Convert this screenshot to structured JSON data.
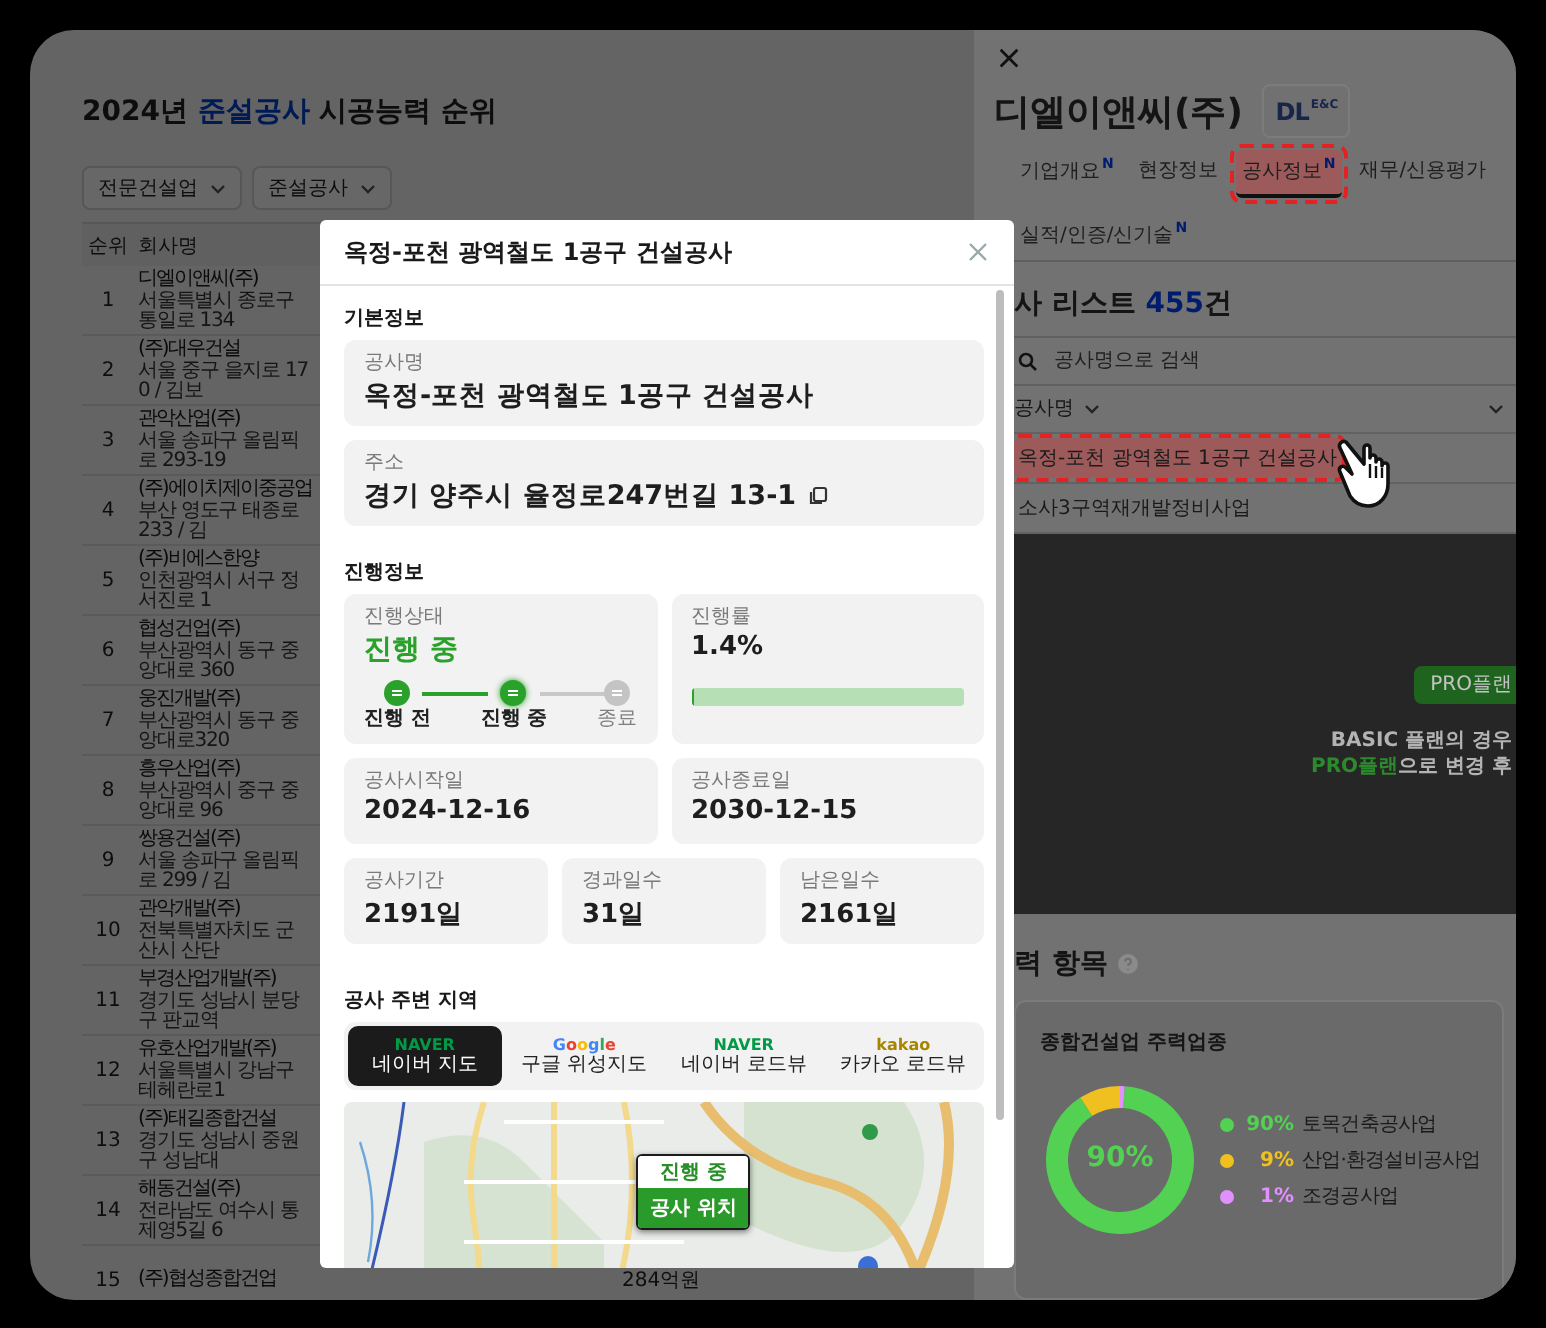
{
  "left_page": {
    "title": {
      "prefix": "2024년",
      "highlight": "준설공사",
      "suffix": "시공능력 순위"
    },
    "filters": [
      {
        "label": "전문건설업"
      },
      {
        "label": "준설공사"
      }
    ],
    "table": {
      "columns": [
        "순위",
        "회사명"
      ],
      "rows": [
        {
          "rank": "1",
          "name": "디엘이앤씨(주)",
          "address": "서울특별시 종로구 통일로 134"
        },
        {
          "rank": "2",
          "name": "(주)대우건설",
          "address": "서울 중구 을지로 170 / 김보"
        },
        {
          "rank": "3",
          "name": "관악산업(주)",
          "address": "서울 송파구 올림픽로 293-19"
        },
        {
          "rank": "4",
          "name": "(주)에이치제이중공업",
          "address": "부산 영도구 태종로 233 / 김"
        },
        {
          "rank": "5",
          "name": "(주)비에스한양",
          "address": "인천광역시 서구 정서진로 1"
        },
        {
          "rank": "6",
          "name": "협성건업(주)",
          "address": "부산광역시 동구 중앙대로 360"
        },
        {
          "rank": "7",
          "name": "웅진개발(주)",
          "address": "부산광역시 동구 중앙대로320"
        },
        {
          "rank": "8",
          "name": "흥우산업(주)",
          "address": "부산광역시 중구 중앙대로 96"
        },
        {
          "rank": "9",
          "name": "쌍용건설(주)",
          "address": "서울 송파구 올림픽로 299 / 김"
        },
        {
          "rank": "10",
          "name": "관악개발(주)",
          "address": "전북특별자치도 군산시 산단"
        },
        {
          "rank": "11",
          "name": "부경산업개발(주)",
          "address": "경기도 성남시 분당구 판교역"
        },
        {
          "rank": "12",
          "name": "유호산업개발(주)",
          "address": "서울특별시 강남구 테헤란로1"
        },
        {
          "rank": "13",
          "name": "(주)태길종합건설",
          "address": "경기도 성남시 중원구 성남대"
        },
        {
          "rank": "14",
          "name": "해동건설(주)",
          "address": "전라남도 여수시 통제영5길 6"
        },
        {
          "rank": "15",
          "name": "(주)협성종합건업",
          "amount": "284억원"
        }
      ]
    }
  },
  "panel": {
    "company": "디엘이앤씨(주)",
    "logo": {
      "mark": "DL",
      "sub": "E&C"
    },
    "tabs": [
      {
        "label": "기업개요",
        "badge": "N",
        "selected": false,
        "highlighted": false
      },
      {
        "label": "현장정보",
        "selected": false,
        "highlighted": false
      },
      {
        "label": "공사정보",
        "badge": "N",
        "selected": true,
        "highlighted": true
      },
      {
        "label": "재무/신용평가",
        "selected": false,
        "highlighted": false
      },
      {
        "label": "실적/인증/신기술",
        "badge": "N",
        "selected": false,
        "highlighted": false
      }
    ],
    "list": {
      "title": "사 리스트",
      "count": "455",
      "unit": "건",
      "search": {
        "placeholder": "공사명으로 검색"
      },
      "column": "공사명",
      "rows": [
        {
          "name": "옥정-포천 광역철도 1공구 건설공사",
          "highlighted": true
        },
        {
          "name": "소사3구역재개발정비사업",
          "highlighted": false
        }
      ]
    },
    "locked": {
      "button": "PRO플랜",
      "note": "BASIC 플랜의 경우",
      "note2": {
        "highlight": "PRO플랜",
        "rest": "으로 변경 후"
      }
    },
    "focus": {
      "title": "력 항목",
      "center_label": "90%",
      "chart_data": {
        "type": "donut",
        "title": "종합건설업 주력업종",
        "categories": [
          "토목건축공사업",
          "산업·환경설비공사업",
          "조경공사업"
        ],
        "values": [
          90,
          9,
          1
        ]
      },
      "legend": [
        {
          "value": "90%",
          "color": "#52d152"
        },
        {
          "value": "9%",
          "color": "#f0c020"
        },
        {
          "value": "1%",
          "color": "#e090ff"
        }
      ]
    }
  },
  "modal": {
    "title": "옥정-포천 광역철도 1공구 건설공사",
    "basic": {
      "heading": "기본정보",
      "fields": [
        {
          "label": "공사명",
          "value": "옥정-포천 광역철도 1공구 건설공사",
          "copyable": false
        },
        {
          "label": "주소",
          "value": "경기 양주시 율정로247번길 13-1",
          "copyable": true
        }
      ]
    },
    "progress": {
      "heading": "진행정보",
      "status": {
        "label": "진행상태",
        "value": "진행 중",
        "steps": [
          {
            "label": "진행 전",
            "reached": true,
            "current": false
          },
          {
            "label": "진행 중",
            "reached": true,
            "current": true
          },
          {
            "label": "종료",
            "reached": false,
            "current": false
          }
        ]
      },
      "rate": {
        "label": "진행률",
        "value": "1.4%",
        "level": 0.014
      },
      "dates": [
        {
          "label": "공사시작일",
          "value": "2024-12-16"
        },
        {
          "label": "공사종료일",
          "value": "2030-12-15"
        }
      ],
      "durations": [
        {
          "label": "공사기간",
          "value": "2191일"
        },
        {
          "label": "경과일수",
          "value": "31일"
        },
        {
          "label": "남은일수",
          "value": "2161일"
        }
      ]
    },
    "area": {
      "heading": "공사 주변 지역",
      "tabs": [
        {
          "kind": "naver",
          "brand": "NAVER",
          "label": "네이버 지도",
          "selected": true
        },
        {
          "kind": "google",
          "brand": "Google",
          "label": "구글 위성지도",
          "selected": false
        },
        {
          "kind": "naver",
          "brand": "NAVER",
          "label": "네이버 로드뷰",
          "selected": false
        },
        {
          "kind": "kakao",
          "brand": "kakao",
          "label": "카카오 로드뷰",
          "selected": false
        }
      ],
      "marker": {
        "status": "진행 중",
        "label": "공사 위치"
      }
    }
  }
}
